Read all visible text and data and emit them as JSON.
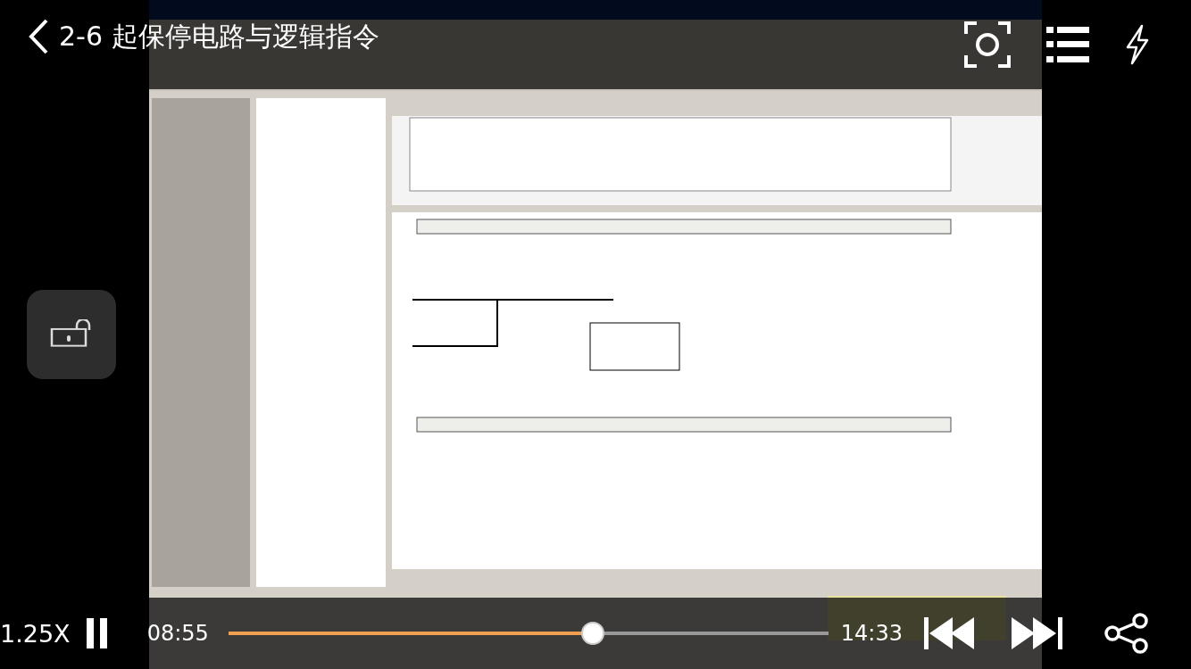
{
  "header": {
    "title": "2-6 起保停电路与逻辑指令"
  },
  "lock": {
    "locked": false
  },
  "controls": {
    "speed": "1.25X",
    "playing": true,
    "elapsed": "08:55",
    "progress": {
      "level": 0.607
    },
    "duration": "14:33"
  }
}
